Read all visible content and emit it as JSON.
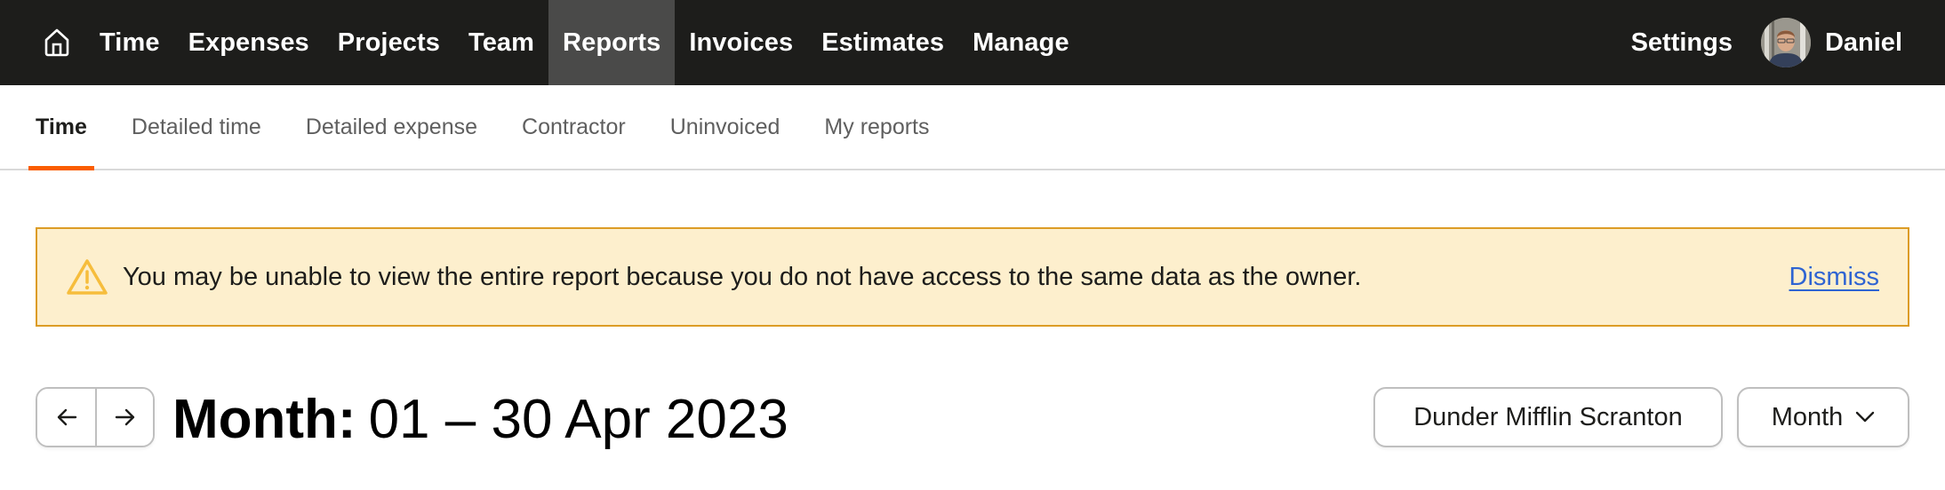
{
  "topnav": {
    "home_icon": "home-icon",
    "items": [
      {
        "label": "Time",
        "active": false
      },
      {
        "label": "Expenses",
        "active": false
      },
      {
        "label": "Projects",
        "active": false
      },
      {
        "label": "Team",
        "active": false
      },
      {
        "label": "Reports",
        "active": true
      },
      {
        "label": "Invoices",
        "active": false
      },
      {
        "label": "Estimates",
        "active": false
      },
      {
        "label": "Manage",
        "active": false
      }
    ],
    "settings_label": "Settings",
    "user_name": "Daniel"
  },
  "subtabs": {
    "items": [
      {
        "label": "Time",
        "active": true
      },
      {
        "label": "Detailed time",
        "active": false
      },
      {
        "label": "Detailed expense",
        "active": false
      },
      {
        "label": "Contractor",
        "active": false
      },
      {
        "label": "Uninvoiced",
        "active": false
      },
      {
        "label": "My reports",
        "active": false
      }
    ]
  },
  "banner": {
    "icon": "warning-icon",
    "message": "You may be unable to view the entire report because you do not have access to the same data as the owner.",
    "dismiss_label": "Dismiss"
  },
  "report": {
    "prev_icon": "arrow-left-icon",
    "next_icon": "arrow-right-icon",
    "title_prefix": "Month:",
    "title_range": "01 – 30 Apr 2023",
    "client_filter": "Dunder Mifflin Scranton",
    "period_select": "Month"
  },
  "colors": {
    "nav_bg": "#1d1d1b",
    "nav_active_bg": "#4a4a49",
    "tab_accent": "#fa5d00",
    "banner_bg": "#fdefcd",
    "banner_border": "#dc9c26",
    "warning_icon": "#f6bd3c",
    "link": "#2e64d2"
  }
}
